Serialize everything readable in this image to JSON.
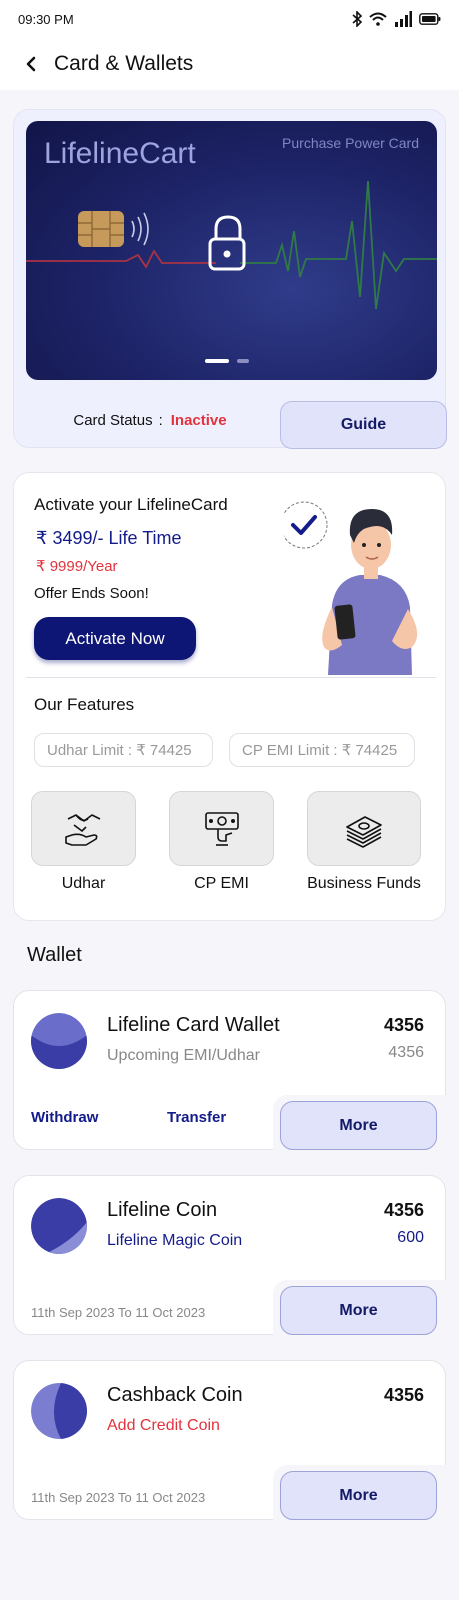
{
  "status_bar": {
    "time": "09:30 PM"
  },
  "header": {
    "title": "Card & Wallets"
  },
  "card": {
    "brand": "LifelineCart",
    "type_label": "Purchase Power Card",
    "status_label": "Card Status",
    "status_separator": ":",
    "status_value": "Inactive",
    "guide_label": "Guide",
    "carousel_pages": 2,
    "carousel_active": 1
  },
  "activation": {
    "title": "Activate your LifelineCard",
    "price_lifetime": "₹ 3499/- Life Time",
    "price_yearly": "₹ 9999/Year",
    "offer": "Offer Ends Soon!",
    "button_label": "Activate Now"
  },
  "features": {
    "title": "Our Features",
    "udhar_limit": "Udhar Limit : ₹ 74425",
    "cp_emi_limit": "CP EMI Limit : ₹ 74425",
    "items": [
      {
        "label": "Udhar",
        "icon": "handshake-icon"
      },
      {
        "label": "CP EMI",
        "icon": "money-hand-icon"
      },
      {
        "label": "Business Funds",
        "icon": "cash-stack-icon"
      }
    ]
  },
  "wallet_heading": "Wallet",
  "wallets": [
    {
      "name": "Lifeline Card Wallet",
      "subtitle": "Upcoming EMI/Udhar",
      "amount": "4356",
      "secondary_amount": "4356",
      "withdraw_label": "Withdraw",
      "transfer_label": "Transfer",
      "more_label": "More"
    },
    {
      "name": "Lifeline Coin",
      "subtitle": "Lifeline Magic Coin",
      "amount": "4356",
      "secondary_amount": "600",
      "date_range": "11th Sep 2023 To 11 Oct 2023",
      "more_label": "More"
    },
    {
      "name": "Cashback Coin",
      "subtitle": "Add Credit Coin",
      "amount": "4356",
      "date_range": "11th Sep 2023 To 11 Oct 2023",
      "more_label": "More"
    }
  ],
  "colors": {
    "primary": "#0d1575",
    "accent_red": "#e2333d",
    "soft_blue": "#e1e3fb",
    "page_bg": "#f6f6fa"
  }
}
